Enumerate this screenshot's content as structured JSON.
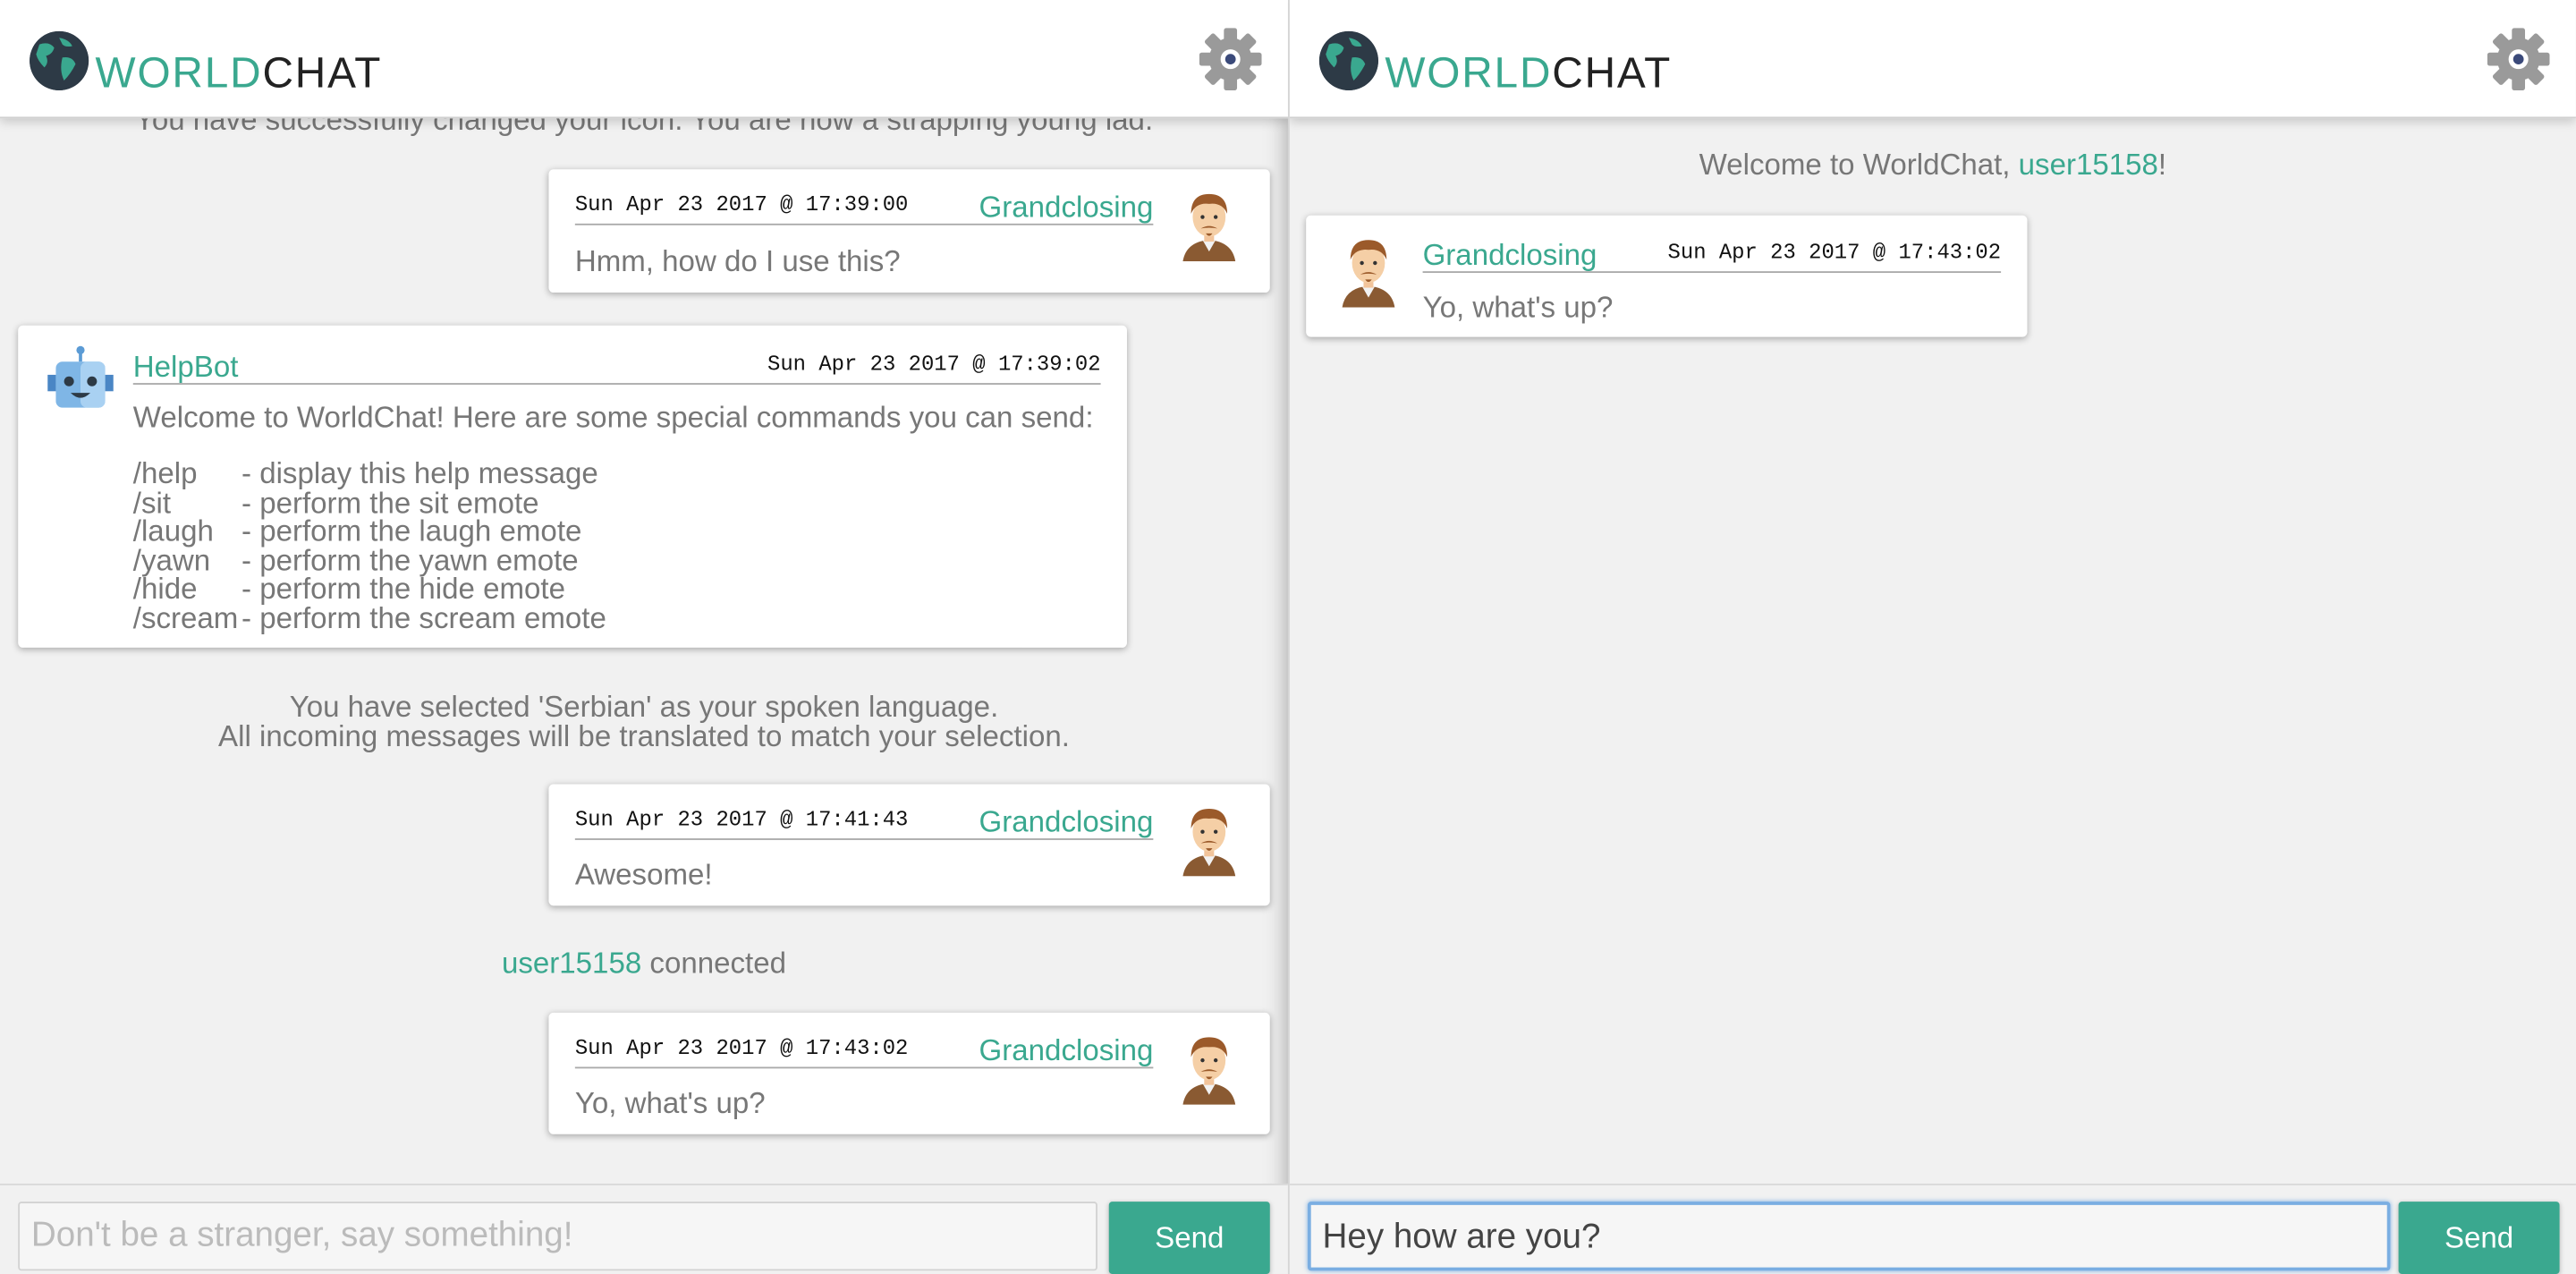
{
  "brand": {
    "world": "WORLD",
    "chat": "CHAT"
  },
  "left": {
    "clipped_text": "You have successfully changed your icon. You are now a strapping young lad.",
    "msg1": {
      "time": "Sun Apr 23 2017 @ 17:39:00",
      "name": "Grandclosing",
      "text": "Hmm, how do I use this?"
    },
    "helpbot": {
      "name": "HelpBot",
      "time": "Sun Apr 23 2017 @ 17:39:02",
      "intro": "Welcome to WorldChat! Here are some special commands you can send:",
      "commands": [
        {
          "cmd": "/help",
          "desc": "- display this help message"
        },
        {
          "cmd": "/sit",
          "desc": "- perform the sit emote"
        },
        {
          "cmd": "/laugh",
          "desc": "- perform the laugh emote"
        },
        {
          "cmd": "/yawn",
          "desc": "- perform the yawn emote"
        },
        {
          "cmd": "/hide",
          "desc": "- perform the hide emote"
        },
        {
          "cmd": "/scream",
          "desc": "- perform the scream emote"
        }
      ]
    },
    "lang_line1": "You have selected 'Serbian' as your spoken language.",
    "lang_line2": "All incoming messages will be translated to match your selection.",
    "msg2": {
      "time": "Sun Apr 23 2017 @ 17:41:43",
      "name": "Grandclosing",
      "text": "Awesome!"
    },
    "connected_user": "user15158",
    "connected_text": " connected",
    "msg3": {
      "time": "Sun Apr 23 2017 @ 17:43:02",
      "name": "Grandclosing",
      "text": "Yo, what's up?"
    },
    "composer": {
      "placeholder": "Don't be a stranger, say something!",
      "send": "Send"
    }
  },
  "right": {
    "welcome_prefix": "Welcome to WorldChat, ",
    "welcome_user": "user15158",
    "welcome_suffix": "!",
    "msg1": {
      "time": "Sun Apr 23 2017 @ 17:43:02",
      "name": "Grandclosing",
      "text": "Yo, what's up?"
    },
    "composer": {
      "value": "Hey how are you?",
      "send": "Send"
    }
  },
  "colors": {
    "accent": "#3aa88f",
    "focus": "#7aaee2"
  }
}
